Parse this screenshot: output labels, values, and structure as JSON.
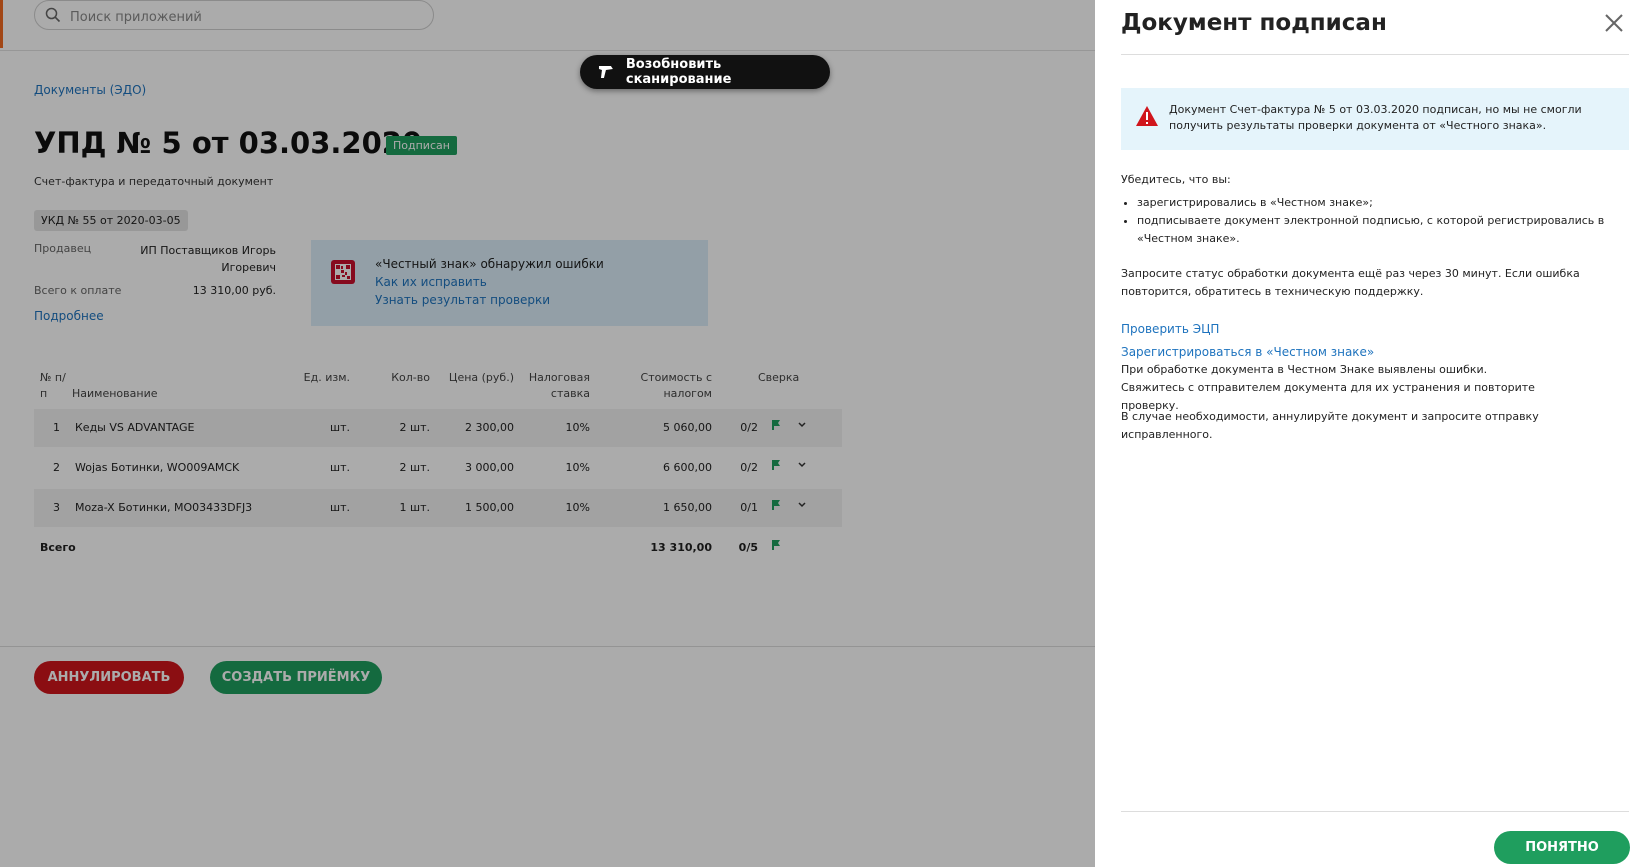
{
  "search": {
    "placeholder": "Поиск приложений"
  },
  "scan_button": {
    "label": "Возобновить сканирование"
  },
  "breadcrumb": "Документы (ЭДО)",
  "document": {
    "title": "УПД № 5 от 03.03.2020",
    "status": "Подписан",
    "subtitle": "Счет-фактура и передаточный документ",
    "ukd_tag": "УКД № 55 от 2020-03-05",
    "seller_label": "Продавец",
    "seller_value": "ИП Поставщиков Игорь Игоревич",
    "total_label": "Всего к оплате",
    "total_value": "13 310,00 руб.",
    "more_link": "Подробнее"
  },
  "alert": {
    "title": "«Честный знак» обнаружил ошибки",
    "link_fix": "Как их исправить",
    "link_result": "Узнать результат проверки"
  },
  "table": {
    "headers": {
      "num": "№ п/п",
      "name": "Наименование",
      "unit": "Ед. изм.",
      "qty": "Кол-во",
      "price": "Цена (руб.)",
      "tax": "Налоговая ставка",
      "cost": "Стоимость с налогом",
      "check": "Сверка"
    },
    "rows": [
      {
        "num": "1",
        "name": "Кеды VS ADVANTAGE",
        "unit": "шт.",
        "qty": "2 шт.",
        "price": "2 300,00",
        "tax": "10%",
        "cost": "5 060,00",
        "check": "0/2"
      },
      {
        "num": "2",
        "name": "Wojas Ботинки, WO009AMCK",
        "unit": "шт.",
        "qty": "2 шт.",
        "price": "3 000,00",
        "tax": "10%",
        "cost": "6 600,00",
        "check": "0/2"
      },
      {
        "num": "3",
        "name": "Moza-X Ботинки, MO03433DFJ3",
        "unit": "шт.",
        "qty": "1 шт.",
        "price": "1 500,00",
        "tax": "10%",
        "cost": "1 650,00",
        "check": "0/1"
      }
    ],
    "total": {
      "label": "Всего",
      "cost": "13 310,00",
      "check": "0/5"
    }
  },
  "actions": {
    "cancel": "АННУЛИРОВАТЬ",
    "create": "СОЗДАТЬ ПРИЁМКУ"
  },
  "panel": {
    "title": "Документ подписан",
    "warning": "Документ Счет-фактура № 5 от 03.03.2020 подписан, но мы не смогли получить результаты проверки документа от «Честного знака».",
    "check_intro": "Убедитесь, что вы:",
    "check_items": [
      "зарегистрировались в «Честном знаке»;",
      "подписываете документ электронной подписью, с которой регистрировались в «Честном знаке»."
    ],
    "retry_text": "Запросите статус обработки документа ещё раз через 30 минут. Если ошибка повторится, обратитесь в техническую поддержку.",
    "link_check_signature": "Проверить ЭЦП",
    "link_register": "Зарегистрироваться в «Честном знаке»",
    "errors_text": "При обработке документа в Честном Знаке выявлены ошибки. Свяжитесь с отправителем документа для их устранения и повторите проверку.",
    "annul_text": "В случае необходимости, аннулируйте документ и запросите отправку исправленного.",
    "ok_button": "ПОНЯТНО"
  },
  "colors": {
    "accent_green": "#1f9e5e",
    "danger_red": "#d0151c",
    "link_blue": "#1e73be",
    "brand_orange": "#f26a21"
  }
}
